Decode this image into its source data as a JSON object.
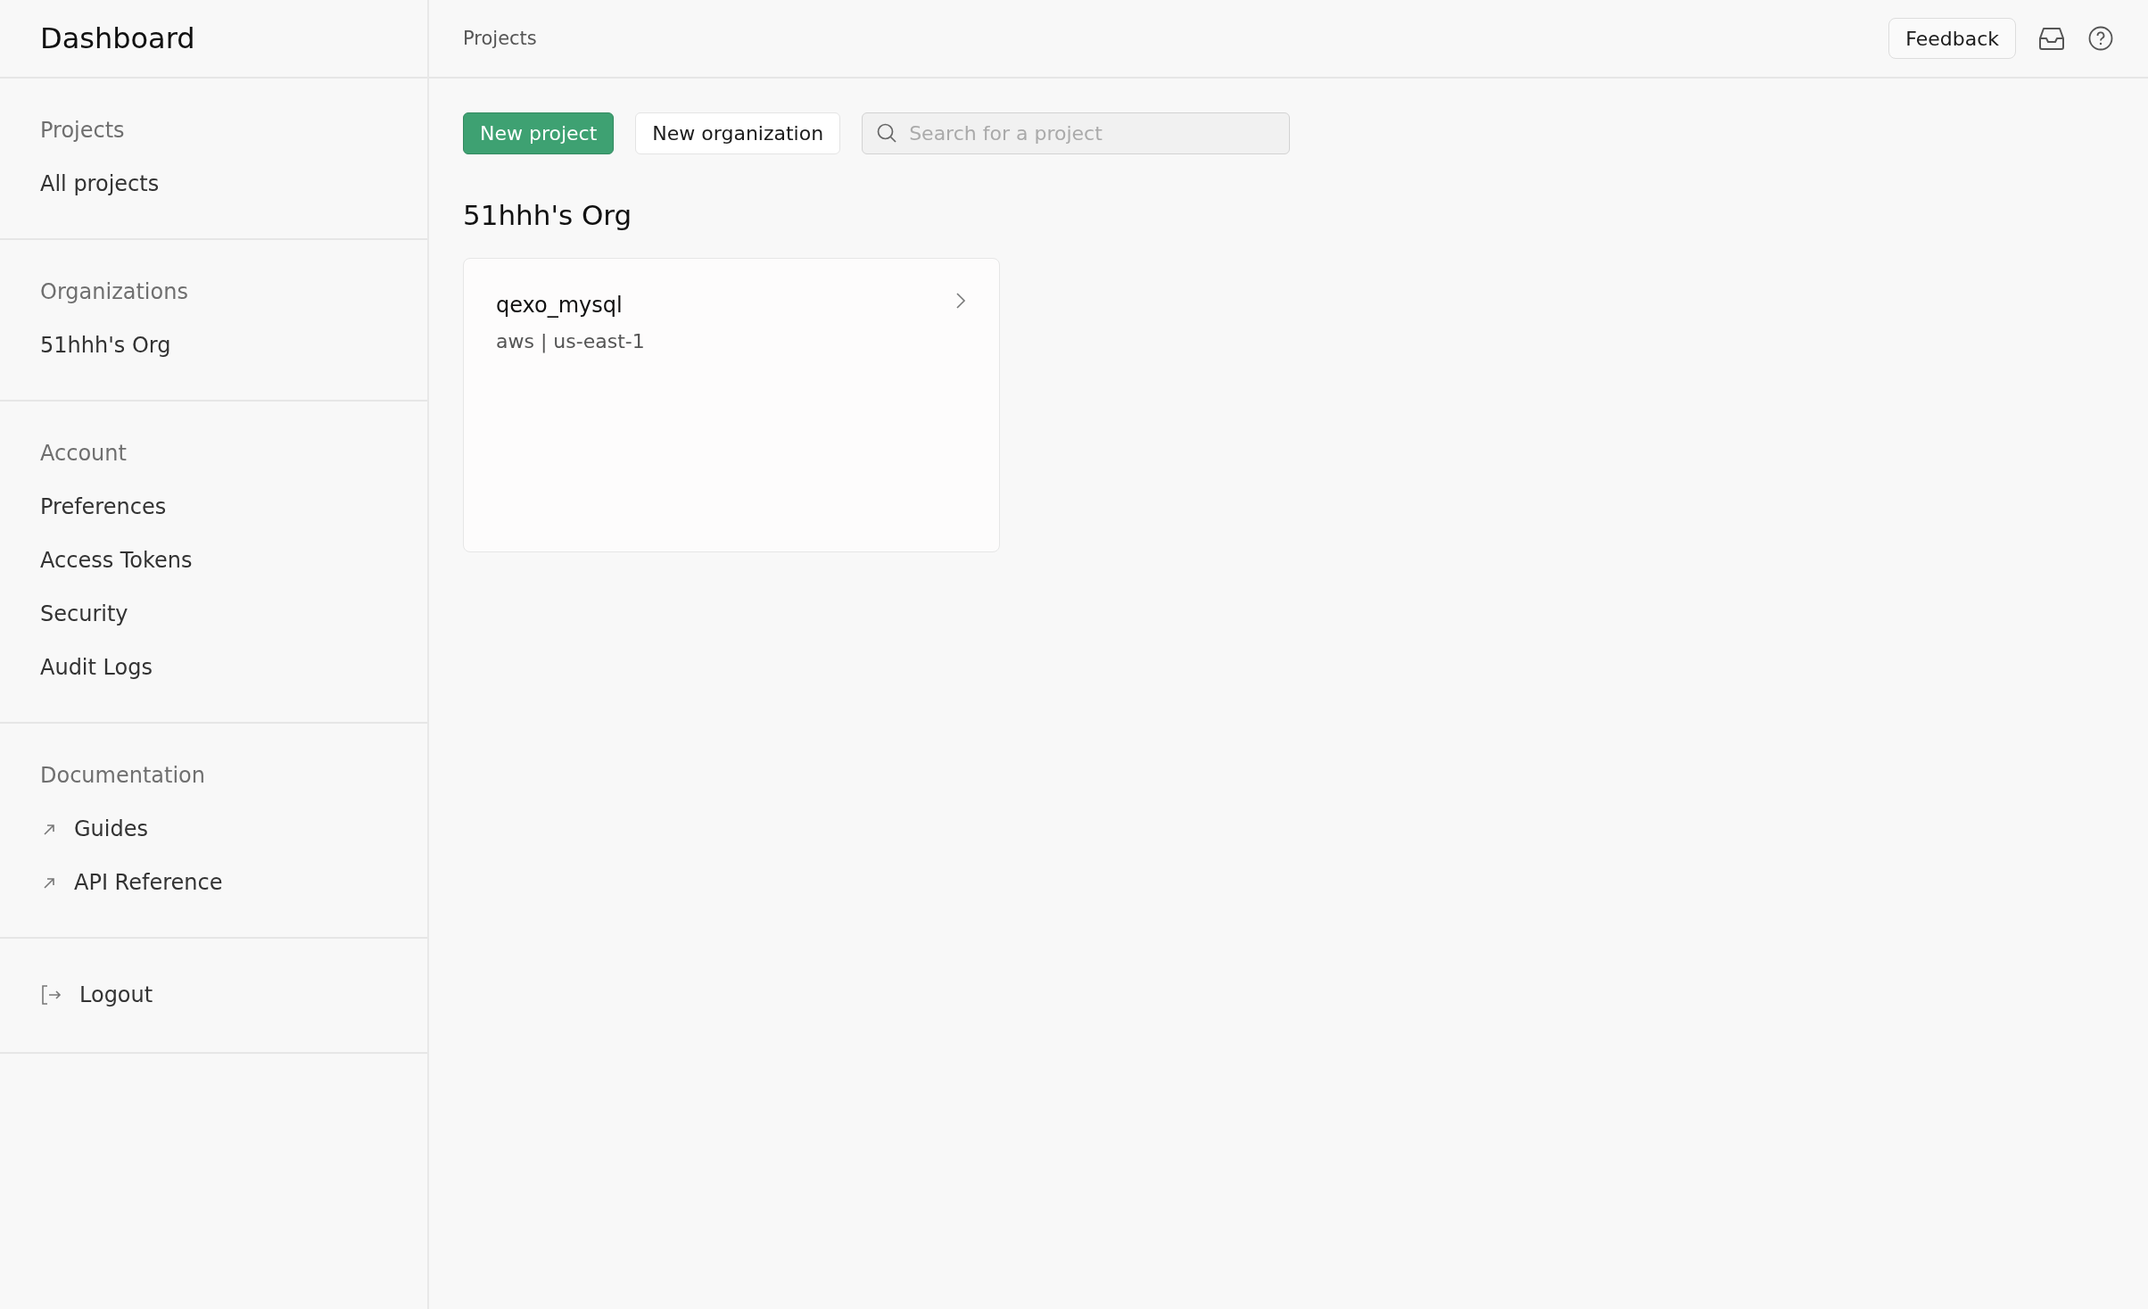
{
  "sidebar": {
    "title": "Dashboard",
    "sections": [
      {
        "heading": "Projects",
        "items": [
          {
            "label": "All projects",
            "kind": "plain"
          }
        ]
      },
      {
        "heading": "Organizations",
        "items": [
          {
            "label": "51hhh's Org",
            "kind": "plain"
          }
        ]
      },
      {
        "heading": "Account",
        "items": [
          {
            "label": "Preferences",
            "kind": "plain"
          },
          {
            "label": "Access Tokens",
            "kind": "plain"
          },
          {
            "label": "Security",
            "kind": "plain"
          },
          {
            "label": "Audit Logs",
            "kind": "plain"
          }
        ]
      },
      {
        "heading": "Documentation",
        "items": [
          {
            "label": "Guides",
            "kind": "external"
          },
          {
            "label": "API Reference",
            "kind": "external"
          }
        ]
      },
      {
        "items": [
          {
            "label": "Logout",
            "kind": "logout"
          }
        ]
      }
    ]
  },
  "topbar": {
    "breadcrumb": "Projects",
    "feedback": "Feedback"
  },
  "toolbar": {
    "new_project": "New project",
    "new_organization": "New organization",
    "search": {
      "placeholder": "Search for a project"
    }
  },
  "organizations": [
    {
      "name": "51hhh's Org",
      "projects": [
        {
          "name": "qexo_mysql",
          "detail": "aws | us-east-1"
        }
      ]
    }
  ]
}
